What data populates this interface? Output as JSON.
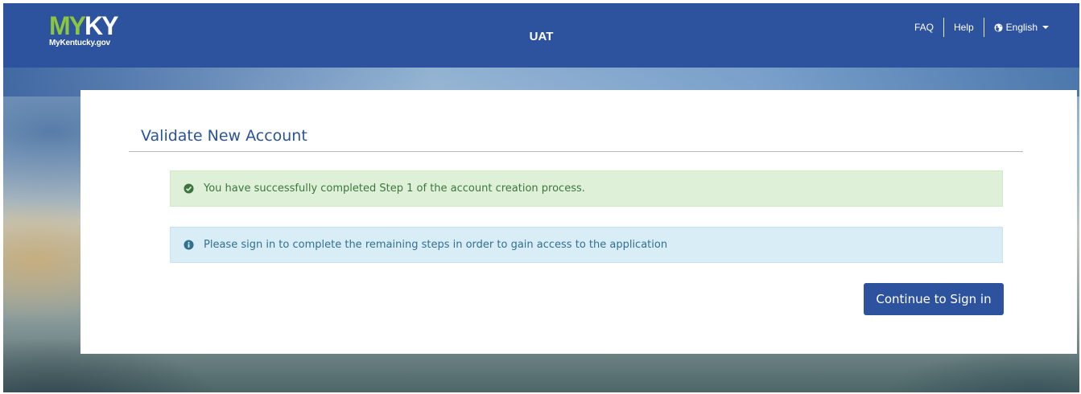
{
  "header": {
    "logo_primary_my": "MY",
    "logo_primary_ky": "KY",
    "logo_subtitle": "MyKentucky.gov",
    "environment": "UAT",
    "nav": {
      "faq": "FAQ",
      "help": "Help",
      "language": "English"
    },
    "colors": {
      "bar": "#2d539f",
      "logo_my": "#8cc63f"
    },
    "icons": {
      "language": "globe-icon",
      "dropdown": "caret-down-icon"
    }
  },
  "card": {
    "title": "Validate New Account",
    "alerts": [
      {
        "type": "success",
        "icon": "check-circle-icon",
        "text": "You have successfully completed Step 1 of the account creation process."
      },
      {
        "type": "info",
        "icon": "info-circle-icon",
        "text": "Please sign in to complete the remaining steps in order to gain access to the application"
      }
    ],
    "continue_button": "Continue to Sign in"
  }
}
